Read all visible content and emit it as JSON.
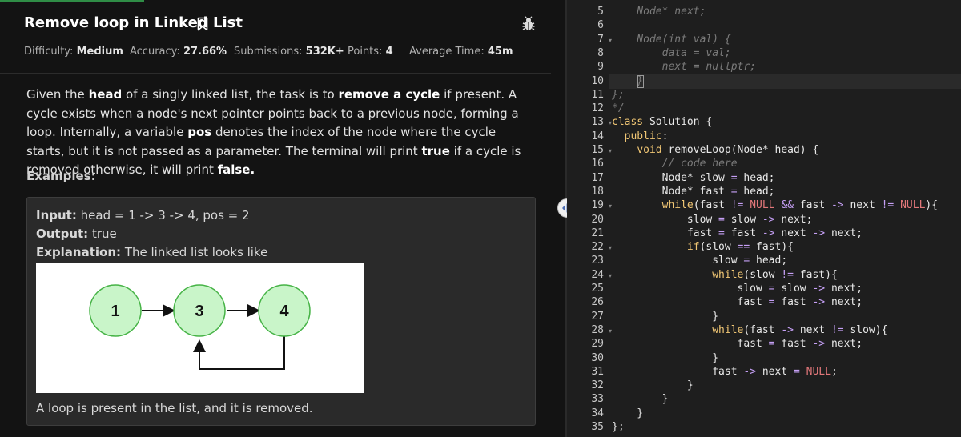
{
  "problem": {
    "title": "Remove loop in Linked List",
    "meta": [
      {
        "label": "Difficulty:",
        "value": "Medium"
      },
      {
        "label": "Accuracy:",
        "value": "27.66%"
      },
      {
        "label": "Submissions:",
        "value": "532K+"
      },
      {
        "label": "Points:",
        "value": "4"
      },
      {
        "label": "Average Time:",
        "value": "45m"
      }
    ],
    "description": {
      "p1": "Given the ",
      "b1": "head",
      "p2": " of a singly linked list, the task is to ",
      "b2": "remove a cycle",
      "p3": " if present. A cycle exists when a node's next pointer points back to a previous node, forming a loop. Internally, a variable ",
      "b3": "pos",
      "p4": " denotes the index of the node where the cycle starts, but it is not passed as a parameter. The terminal will print ",
      "b4": "true",
      "p5": " if a cycle is removed otherwise, it will print ",
      "b5": "false."
    },
    "examples_heading": "Examples:",
    "example": {
      "input_label": "Input:",
      "input_value": "head = 1 -> 3 -> 4, pos = 2",
      "output_label": "Output:",
      "output_value": "true",
      "explanation_label": "Explanation:",
      "explanation_value": "The linked list looks like",
      "nodes": [
        "1",
        "3",
        "4"
      ],
      "footer": "A loop is present in the list, and it is removed."
    }
  },
  "editor": {
    "line_numbers": [
      "5",
      "6",
      "7",
      "8",
      "9",
      "10",
      "11",
      "12",
      "13",
      "14",
      "15",
      "16",
      "17",
      "18",
      "19",
      "20",
      "21",
      "22",
      "23",
      "24",
      "25",
      "26",
      "27",
      "28",
      "29",
      "30",
      "31",
      "32",
      "33",
      "34",
      "35"
    ],
    "lines": [
      "    Node* next;",
      "",
      "    Node(int val) {",
      "        data = val;",
      "        next = nullptr;",
      "    }",
      "};",
      "*/",
      "class Solution {",
      "  public:",
      "    void removeLoop(Node* head) {",
      "        // code here",
      "        Node* slow = head;",
      "        Node* fast = head;",
      "        while(fast != NULL && fast -> next != NULL){",
      "            slow = slow -> next;",
      "            fast = fast -> next -> next;",
      "            if(slow == fast){",
      "                slow = head;",
      "                while(slow != fast){",
      "                    slow = slow -> next;",
      "                    fast = fast -> next;",
      "                }",
      "                while(fast -> next != slow){",
      "                    fast = fast -> next;",
      "                }",
      "                fast -> next = NULL;",
      "            }",
      "        }",
      "    }",
      "};"
    ],
    "fold_lines": [
      "7",
      "13",
      "15",
      "19",
      "22",
      "24",
      "28"
    ],
    "active_line": "10"
  },
  "icons": {
    "bookmark": "bookmark-icon",
    "bug": "bug-icon",
    "splitter": "resize-handle-icon"
  },
  "colors": {
    "accent": "#2f8d46",
    "node_fill": "#c9f5c9",
    "node_stroke": "#46b346",
    "keyword": "#f0c674",
    "null": "#e2777a"
  }
}
